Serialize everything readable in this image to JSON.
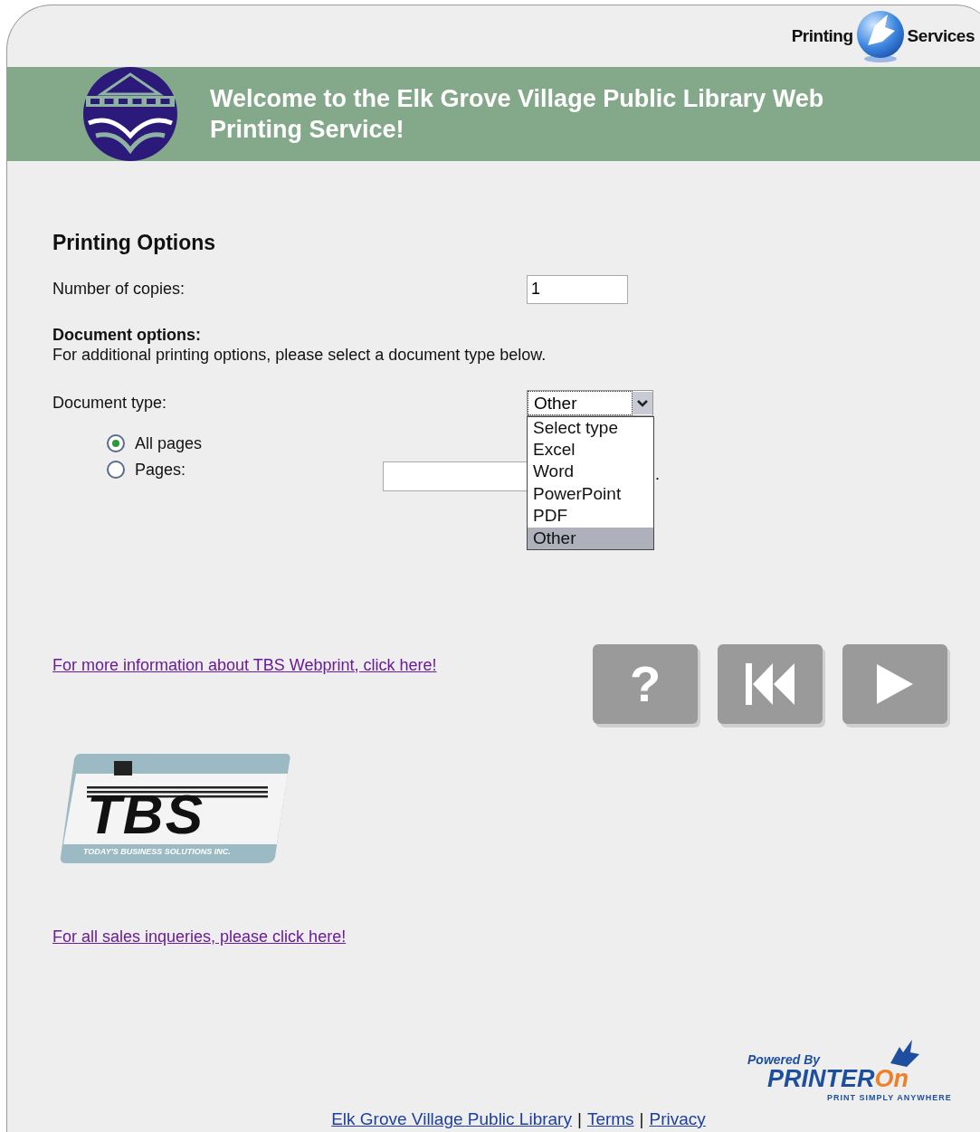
{
  "header": {
    "brand_left": "Printing",
    "brand_right": "Services"
  },
  "banner": {
    "title": "Welcome to the Elk Grove Village Public Library Web Printing Service!"
  },
  "printing_options": {
    "heading": "Printing Options",
    "copies_label": "Number of copies:",
    "copies_value": "1"
  },
  "document_options": {
    "heading": "Document options:",
    "hint": "For additional printing options, please select a document type below.",
    "type_label": "Document type:",
    "type_value": "Other",
    "expanded": true,
    "options": [
      {
        "label": "Select type",
        "selected": false
      },
      {
        "label": "Excel",
        "selected": false
      },
      {
        "label": "Word",
        "selected": false
      },
      {
        "label": "PowerPoint",
        "selected": false
      },
      {
        "label": "PDF",
        "selected": false
      },
      {
        "label": "Other",
        "selected": true
      }
    ],
    "page_choices": [
      {
        "label": "All pages",
        "selected": true,
        "kind": "plain"
      },
      {
        "label": "Pages:",
        "selected": false,
        "kind": "range"
      }
    ],
    "pages_suffix": "."
  },
  "info_link": "For more information about TBS Webprint, click here!",
  "nav_buttons": [
    {
      "kind": "help",
      "label": "?"
    },
    {
      "kind": "first"
    },
    {
      "kind": "next"
    }
  ],
  "tbs_logo": {
    "name": "TBS",
    "tagline": "TODAY'S BUSINESS SOLUTIONS INC."
  },
  "sales_link": "For all sales inqueries, please click here!",
  "printeron": {
    "powered": "Powered By",
    "name_main": "PRINTER",
    "name_accent": "On",
    "tagline": "PRINT SIMPLY ANYWHERE"
  },
  "footer": {
    "links": [
      "Elk Grove Village Public Library",
      "Terms",
      "Privacy"
    ],
    "separator": "|"
  }
}
